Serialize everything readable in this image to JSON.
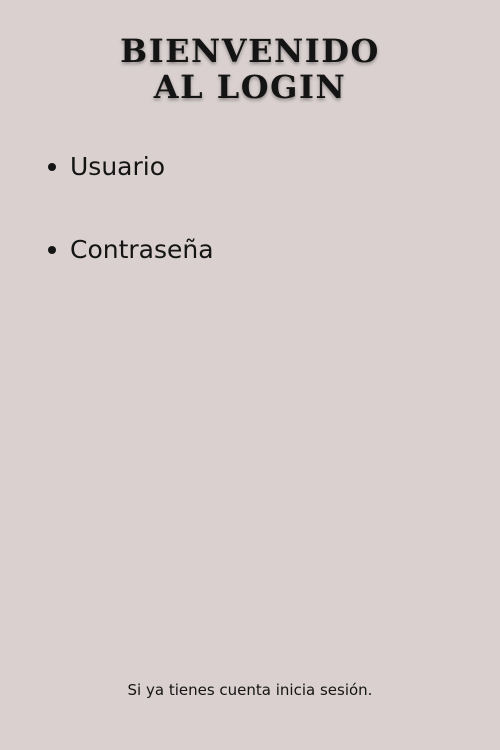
{
  "header": {
    "title_line1": "BIENVENIDO",
    "title_line2": "AL LOGIN"
  },
  "form": {
    "fields": [
      {
        "label": "Usuario"
      },
      {
        "label": "Contraseña"
      }
    ]
  },
  "footer": {
    "login_prompt": "Si ya tienes cuenta inicia sesión."
  },
  "colors": {
    "background": "#d9d0cf",
    "text": "#141414"
  }
}
